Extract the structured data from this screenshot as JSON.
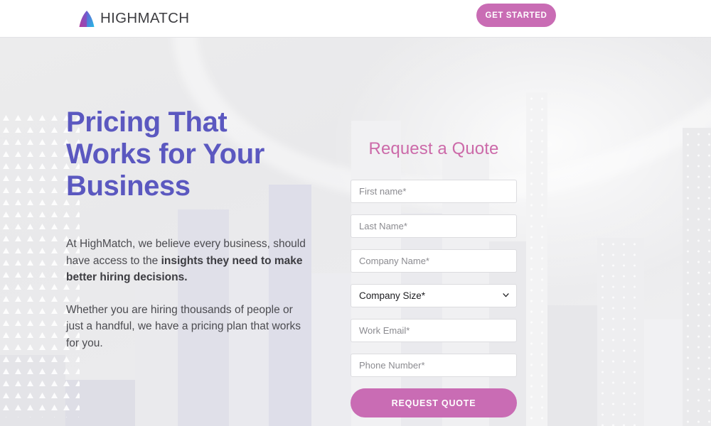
{
  "header": {
    "brand_name": "HIGHMATCH",
    "logo_icon": "highmatch-triangle-logo",
    "cta_label": "GET STARTED"
  },
  "hero": {
    "headline": "Pricing That Works for Your Business",
    "paragraph_1_lead": "At HighMatch, we believe every business, should have access to the ",
    "paragraph_1_bold": "insights they need to make better hiring decisions.",
    "paragraph_2": "Whether you are hiring thousands of people or just a handful, we have a pricing plan that works for you."
  },
  "form": {
    "title": "Request a Quote",
    "fields": [
      {
        "name": "first-name",
        "placeholder": "First name*",
        "value": ""
      },
      {
        "name": "last-name",
        "placeholder": "Last Name*",
        "value": ""
      },
      {
        "name": "company-name",
        "placeholder": "Company Name*",
        "value": ""
      }
    ],
    "company_size": {
      "selected": "Company Size*",
      "chevron_icon": "chevron-down-icon"
    },
    "fields_after": [
      {
        "name": "work-email",
        "placeholder": "Work Email*",
        "value": ""
      },
      {
        "name": "phone-number",
        "placeholder": "Phone Number*",
        "value": ""
      }
    ],
    "submit_label": "REQUEST QUOTE"
  },
  "colors": {
    "brand_pink": "#c96cb4",
    "headline_purple": "#5b58c0",
    "form_title_pink": "#cc6aa9",
    "logo_magenta": "#d6468f",
    "logo_blue": "#2bb6e0",
    "page_background": "#ececed"
  }
}
